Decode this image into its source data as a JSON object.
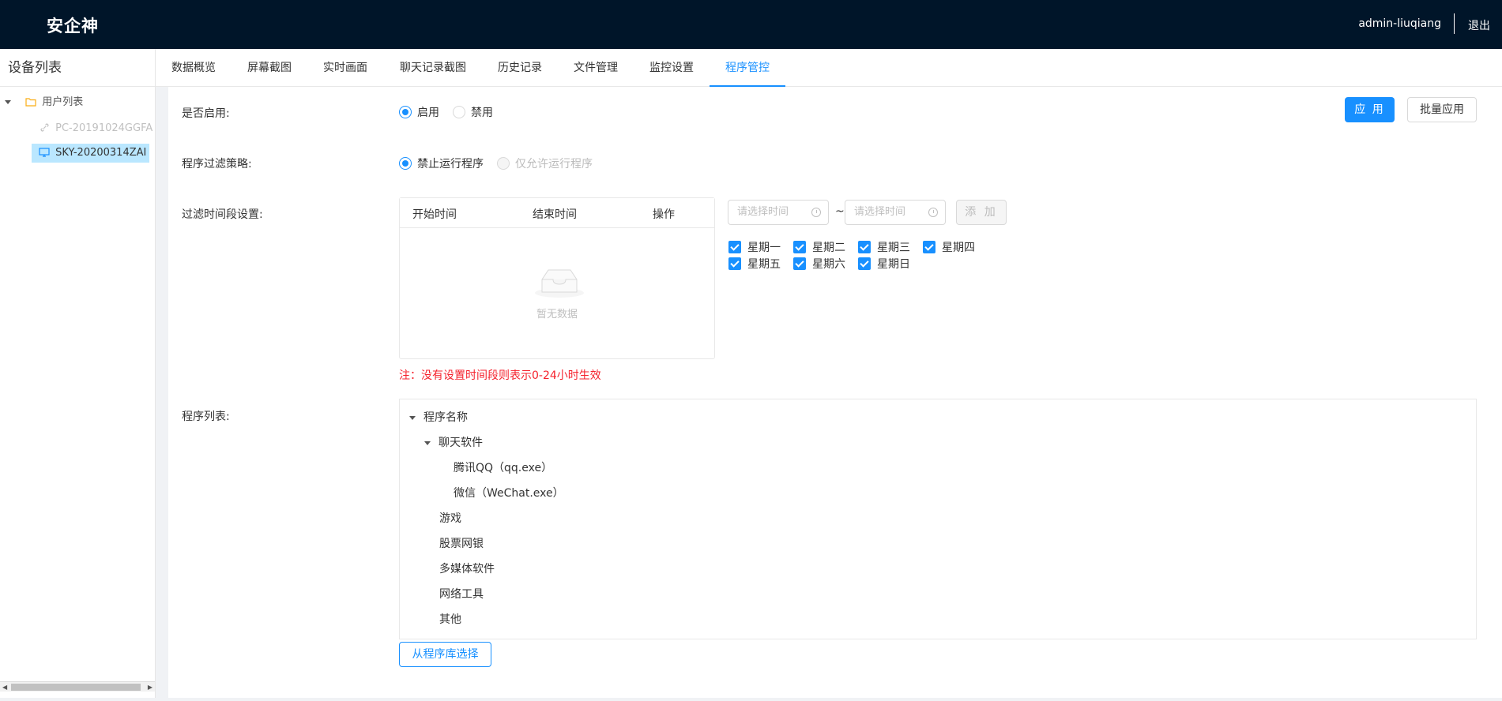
{
  "header": {
    "brand": "安企神",
    "user": "admin-liuqiang",
    "logout": "退出"
  },
  "sidebar": {
    "title": "设备列表",
    "root": "用户列表",
    "devices": [
      {
        "name": "PC-20191024GGFA",
        "status": "offline"
      },
      {
        "name": "SKY-20200314ZAI",
        "status": "online",
        "selected": true
      }
    ]
  },
  "tabs": [
    {
      "label": "数据概览"
    },
    {
      "label": "屏幕截图"
    },
    {
      "label": "实时画面"
    },
    {
      "label": "聊天记录截图"
    },
    {
      "label": "历史记录"
    },
    {
      "label": "文件管理"
    },
    {
      "label": "监控设置"
    },
    {
      "label": "程序管控",
      "active": true
    }
  ],
  "form": {
    "enable_label": "是否启用:",
    "enable_on": "启用",
    "enable_off": "禁用",
    "enable_value": "启用",
    "strategy_label": "程序过滤策略:",
    "strategy_block": "禁止运行程序",
    "strategy_allow": "仅允许运行程序",
    "strategy_value": "禁止运行程序",
    "time_label": "过滤时间段设置:",
    "table_headers": [
      "开始时间",
      "结束时间",
      "操作"
    ],
    "empty_text": "暂无数据",
    "start_placeholder": "请选择时间",
    "end_placeholder": "请选择时间",
    "tilde": "~",
    "add_label": "添 加",
    "weekdays": [
      {
        "label": "星期一",
        "checked": true
      },
      {
        "label": "星期二",
        "checked": true
      },
      {
        "label": "星期三",
        "checked": true
      },
      {
        "label": "星期四",
        "checked": true
      },
      {
        "label": "星期五",
        "checked": true
      },
      {
        "label": "星期六",
        "checked": true
      },
      {
        "label": "星期日",
        "checked": true
      }
    ],
    "note": "注：没有设置时间段则表示0-24小时生效",
    "program_label": "程序列表:",
    "program_tree": {
      "root": "程序名称",
      "chat": "聊天软件",
      "chat_items": [
        "腾讯QQ（qq.exe）",
        "微信（WeChat.exe）"
      ],
      "others": [
        "游戏",
        "股票网银",
        "多媒体软件",
        "网络工具",
        "其他"
      ]
    },
    "from_library": "从程序库选择"
  },
  "actions": {
    "apply": "应 用",
    "batch_apply": "批量应用"
  },
  "colors": {
    "header_bg": "#001529",
    "accent": "#1890ff",
    "note": "#f5222d"
  }
}
